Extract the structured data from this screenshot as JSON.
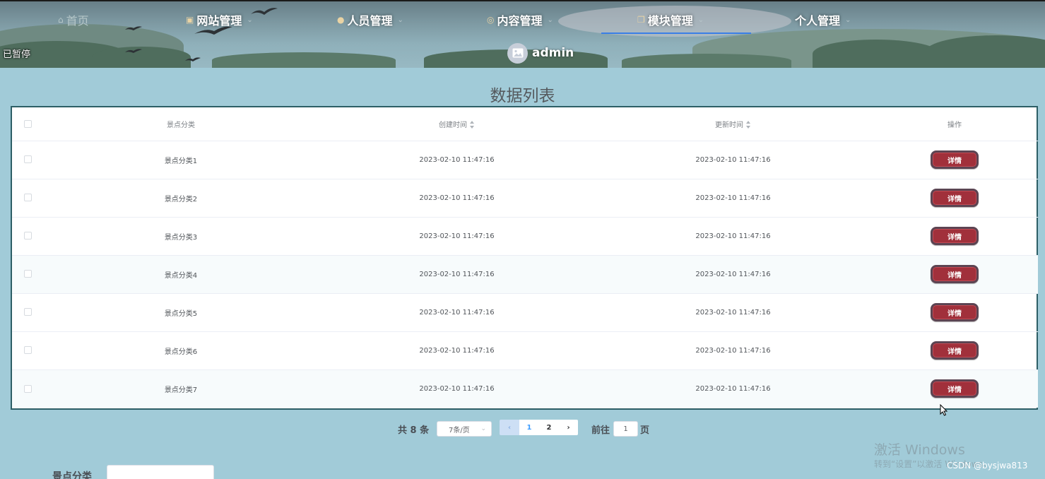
{
  "header": {
    "nav": [
      {
        "label": "首页",
        "icon": "home-icon"
      },
      {
        "label": "网站管理",
        "icon": "cart-icon"
      },
      {
        "label": "人员管理",
        "icon": "user-icon"
      },
      {
        "label": "内容管理",
        "icon": "content-icon"
      },
      {
        "label": "模块管理",
        "icon": "module-icon",
        "active": true
      },
      {
        "label": "个人管理",
        "icon": ""
      }
    ],
    "username": "admin",
    "paused_text": "已暂停"
  },
  "page": {
    "title": "数据列表"
  },
  "table": {
    "columns": [
      "景点分类",
      "创建时间",
      "更新时间",
      "操作"
    ],
    "rows": [
      {
        "category": "景点分类1",
        "created": "2023-02-10 11:47:16",
        "updated": "2023-02-10 11:47:16",
        "action": "详情"
      },
      {
        "category": "景点分类2",
        "created": "2023-02-10 11:47:16",
        "updated": "2023-02-10 11:47:16",
        "action": "详情"
      },
      {
        "category": "景点分类3",
        "created": "2023-02-10 11:47:16",
        "updated": "2023-02-10 11:47:16",
        "action": "详情"
      },
      {
        "category": "景点分类4",
        "created": "2023-02-10 11:47:16",
        "updated": "2023-02-10 11:47:16",
        "action": "详情"
      },
      {
        "category": "景点分类5",
        "created": "2023-02-10 11:47:16",
        "updated": "2023-02-10 11:47:16",
        "action": "详情"
      },
      {
        "category": "景点分类6",
        "created": "2023-02-10 11:47:16",
        "updated": "2023-02-10 11:47:16",
        "action": "详情"
      },
      {
        "category": "景点分类7",
        "created": "2023-02-10 11:47:16",
        "updated": "2023-02-10 11:47:16",
        "action": "详情"
      }
    ]
  },
  "pagination": {
    "total": "共 8 条",
    "page_size": "7条/页",
    "pages": [
      "1",
      "2"
    ],
    "current_page": "1",
    "goto_label": "前往",
    "goto_value": "1",
    "page_unit": "页"
  },
  "form": {
    "category_label": "景点分类",
    "category_value": ""
  },
  "watermarks": {
    "windows_title": "激活 Windows",
    "windows_sub": "转到“设置”以激活 Windows。",
    "csdn": "CSDN @bysjwa813"
  },
  "colors": {
    "accent": "#3a7fe6",
    "button": "#a1303b",
    "page_bg": "#a1cbd8",
    "table_border": "#2d5e66"
  }
}
